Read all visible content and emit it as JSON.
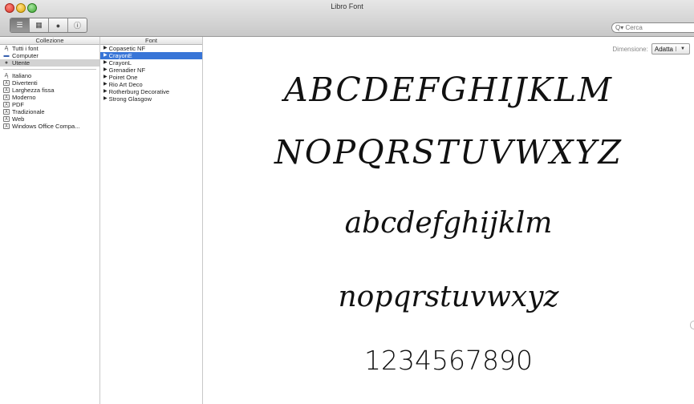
{
  "window": {
    "title": "Libro Font"
  },
  "toolbar": {
    "view_buttons": [
      "list-view-icon",
      "grid-view-icon",
      "user-icon",
      "info-icon"
    ],
    "search_placeholder": "Cerca"
  },
  "collection": {
    "header": "Collezione",
    "items_top": [
      {
        "label": "Tutti i font",
        "icon": "all-fonts-icon"
      },
      {
        "label": "Computer",
        "icon": "computer-icon"
      },
      {
        "label": "Utente",
        "icon": "user-icon"
      }
    ],
    "items_bottom": [
      {
        "label": "Italiano",
        "icon": "all-fonts-icon"
      },
      {
        "label": "Divertenti",
        "icon": "collection-icon"
      },
      {
        "label": "Larghezza fissa",
        "icon": "collection-icon"
      },
      {
        "label": "Moderno",
        "icon": "collection-icon"
      },
      {
        "label": "PDF",
        "icon": "collection-icon"
      },
      {
        "label": "Tradizionale",
        "icon": "collection-icon"
      },
      {
        "label": "Web",
        "icon": "collection-icon"
      },
      {
        "label": "Windows Office Compa...",
        "icon": "collection-icon"
      }
    ]
  },
  "fonts": {
    "header": "Font",
    "items": [
      "Copasetic NF",
      "CrayonE",
      "CrayonL",
      "Grenadier NF",
      "Poiret One",
      "Rio Art Deco",
      "Rotherburg Decorative",
      "Strong Glasgow"
    ]
  },
  "preview": {
    "dimension_label": "Dimensione:",
    "dimension_value": "Adatta",
    "line1": "ABCDEFGHIJKLM",
    "line2": "NOPQRSTUVWXYZ",
    "line3": "abcdefghijklm",
    "line4": "nopqrstuvwxyz",
    "line5": "1234567890"
  },
  "colors": {
    "selection": "#3875d7",
    "titlebar": "#d6d6d6"
  }
}
